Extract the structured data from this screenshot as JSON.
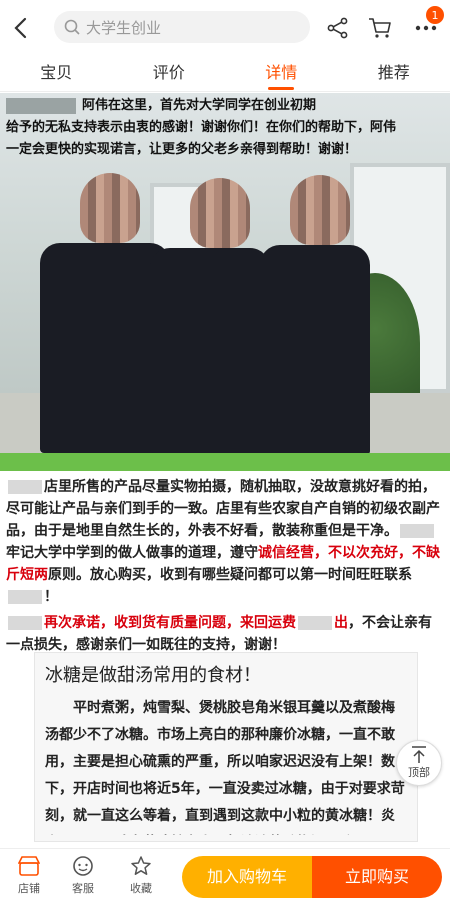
{
  "search": {
    "placeholder": "大学生创业"
  },
  "cart": {
    "badge": "1"
  },
  "tabs": [
    {
      "label": "宝贝"
    },
    {
      "label": "评价"
    },
    {
      "label": "详情"
    },
    {
      "label": "推荐"
    }
  ],
  "photo_caption": {
    "line1": "阿伟在这里，首先对大学同学在创业初期",
    "line2": "给予的无私支持表示由衷的感谢！谢谢你们！在你们的帮助下，阿伟",
    "line3": "一定会更快的实现诺言，让更多的父老乡亲得到帮助！谢谢！"
  },
  "desc": {
    "p1_a": "店里所售的产品尽量实物拍摄，随机抽取，没故意挑好看的拍，尽可能让产品与亲们到手的一致。店里有些农家自产自销的初级农副产品，由于是地里自然生长的，外表不好看，散装称重但是干净。",
    "p1_b": "牢记大学中学到的做人做事的道理，遵守",
    "p1_red": "诚信经营，不以次充好，不缺斤短两",
    "p1_c": "原则。放心购买，收到有哪些疑问都可以第一时间旺旺联系",
    "p2_red1": "再次承诺，收到货有质量问题，来回运费",
    "p2_red2": "出",
    "p2_c": "，不会让亲有一点损失，感谢亲们一如既往的支持，谢谢！"
  },
  "card": {
    "title": "冰糖是做甜汤常用的食材！",
    "body": "平时煮粥，炖雪梨、煲桃胶皂角米银耳羹以及煮酸梅汤都少不了冰糖。市场上亮白的那种廉价冰糖，一直不敢用，主要是担心硫熏的严重，所以咱家迟迟没有上架！数下，开店时间也将近5年，一直没卖过冰糖，由于对要求苛刻，就一直这么等着，直到遇到这款中小粒的黄冰糖！炎炎夏日，用咱家黄冰糖煮上一杯浓浓的酸梅汤，酸"
  },
  "totop": {
    "label": "顶部"
  },
  "bottom": {
    "shop": "店铺",
    "service": "客服",
    "favorite": "收藏",
    "add_cart": "加入购物车",
    "buy_now": "立即购买"
  },
  "colors": {
    "accent": "#ff5000",
    "cart_button": "#ffb000",
    "warning_text": "#d8000c"
  }
}
